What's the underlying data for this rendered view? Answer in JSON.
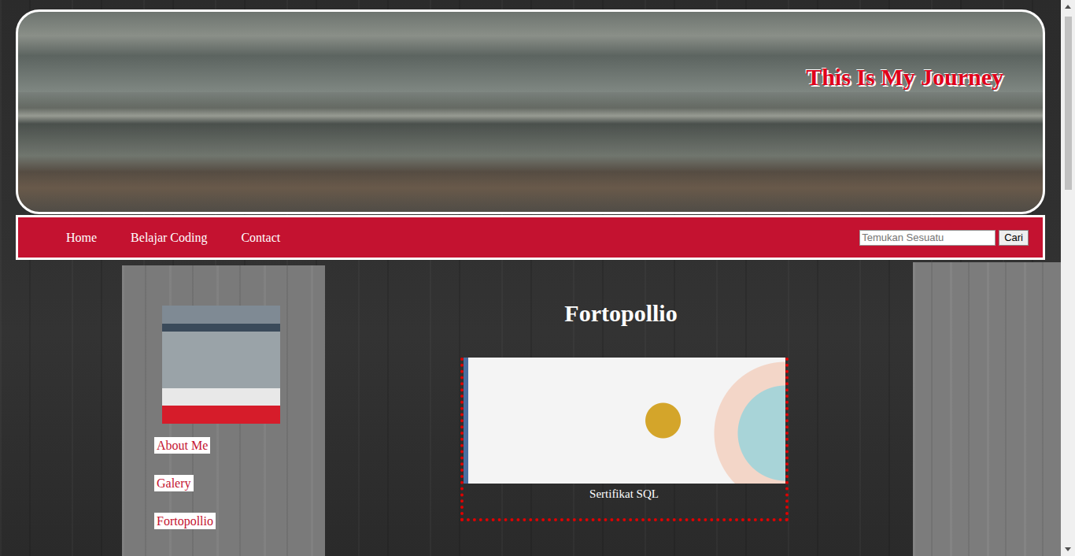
{
  "site": {
    "title": "This Is My Journey"
  },
  "nav": {
    "items": [
      {
        "label": "Home"
      },
      {
        "label": "Belajar Coding"
      },
      {
        "label": "Contact"
      }
    ]
  },
  "search": {
    "placeholder": "Temukan Sesuatu",
    "button": "Cari"
  },
  "sidebar": {
    "items": [
      {
        "label": "About Me"
      },
      {
        "label": "Galery"
      },
      {
        "label": "Fortopollio"
      }
    ]
  },
  "main": {
    "heading": "Fortopollio",
    "cards": [
      {
        "caption": "Sertifikat SQL"
      }
    ]
  }
}
